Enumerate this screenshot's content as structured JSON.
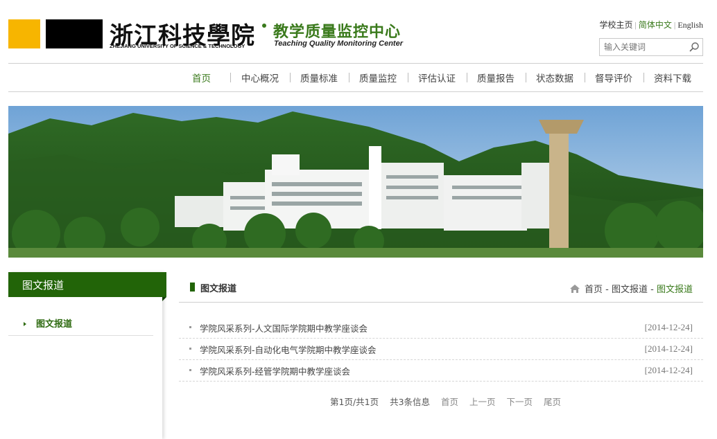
{
  "header": {
    "logo_cn": "浙江科技學院",
    "logo_en": "ZHEJIANG UNIVERSITY OF SCIENCE & TECHNOLOGY",
    "center_cn": "教学质量监控中心",
    "center_en": "Teaching Quality Monitoring Center",
    "toplinks": {
      "home": "学校主页",
      "sep": "|",
      "chinese": "简体中文",
      "english": "English"
    },
    "search_placeholder": "输入关键词"
  },
  "nav": {
    "items": [
      {
        "label": "首页",
        "active": true
      },
      {
        "label": "中心概况"
      },
      {
        "label": "质量标准"
      },
      {
        "label": "质量监控"
      },
      {
        "label": "评估认证"
      },
      {
        "label": "质量报告"
      },
      {
        "label": "状态数据"
      },
      {
        "label": "督导评价"
      },
      {
        "label": "资料下载"
      }
    ]
  },
  "sidebar": {
    "title": "图文报道",
    "items": [
      {
        "label": "图文报道"
      }
    ]
  },
  "main": {
    "title": "图文报道",
    "breadcrumb": {
      "home": "首页",
      "sep": "-",
      "level1": "图文报道",
      "current": "图文报道"
    },
    "list": [
      {
        "title": "学院风采系列-人文国际学院期中教学座谈会",
        "date": "[2014-12-24]"
      },
      {
        "title": "学院风采系列-自动化电气学院期中教学座谈会",
        "date": "[2014-12-24]"
      },
      {
        "title": "学院风采系列-经管学院期中教学座谈会",
        "date": "[2014-12-24]"
      }
    ],
    "pager": {
      "info": "第1页/共1页",
      "total": "共3条信息",
      "first": "首页",
      "prev": "上一页",
      "next": "下一页",
      "last": "尾页"
    }
  },
  "colors": {
    "brand_green": "#226408",
    "accent_green": "#3a7a1c",
    "logo_yellow": "#f7b500"
  },
  "icons": {
    "search": "magnifier-icon",
    "home": "house-icon"
  }
}
